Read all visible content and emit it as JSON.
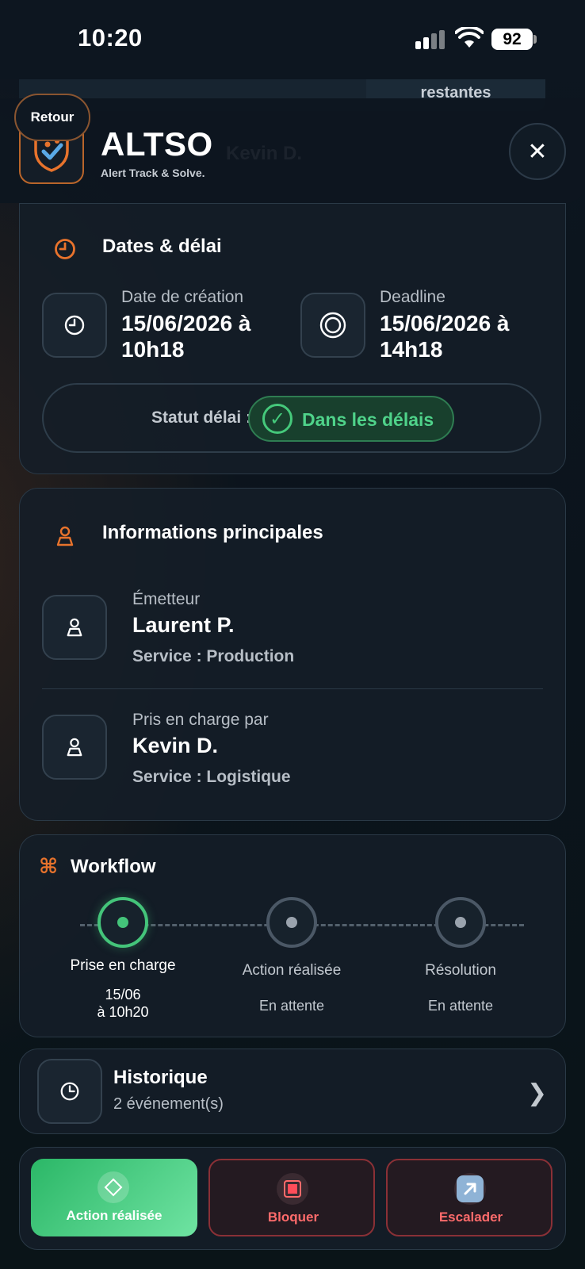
{
  "status_bar": {
    "time": "10:20",
    "battery": "92"
  },
  "behind": {
    "text": "restantes",
    "ghost": "Kevin D."
  },
  "header": {
    "back_label": "Retour",
    "app_name": "ALTSO",
    "tagline": "Alert Track & Solve."
  },
  "dates": {
    "title": "Dates & délai",
    "creation_label": "Date de création",
    "creation_line1": "15/06/2026 à",
    "creation_line2": "10h18",
    "deadline_label": "Deadline",
    "deadline_line1": "15/06/2026 à",
    "deadline_line2": "14h18",
    "status_label": "Statut délai :",
    "status_value": "Dans les délais",
    "status_color": "#4fd38a"
  },
  "info": {
    "title": "Informations principales",
    "issuer_label": "Émetteur",
    "issuer_name": "Laurent P.",
    "issuer_service": "Service : Production",
    "handler_label": "Pris en charge par",
    "handler_name": "Kevin D.",
    "handler_service": "Service : Logistique"
  },
  "workflow": {
    "title": "Workflow",
    "steps": [
      {
        "name": "Prise en charge",
        "line1": "15/06",
        "line2": "à 10h20",
        "state": "done"
      },
      {
        "name": "Action réalisée",
        "line1": "En attente",
        "state": "pending"
      },
      {
        "name": "Résolution",
        "line1": "En attente",
        "state": "pending"
      }
    ],
    "active_color": "#44c47a"
  },
  "history": {
    "title": "Historique",
    "count": "2 événement(s)"
  },
  "actions": {
    "done_label": "Action réalisée",
    "block_label": "Bloquer",
    "escalate_label": "Escalader"
  },
  "colors": {
    "accent_orange": "#e8732c",
    "danger": "#ff6b6b",
    "success": "#44c47a"
  }
}
